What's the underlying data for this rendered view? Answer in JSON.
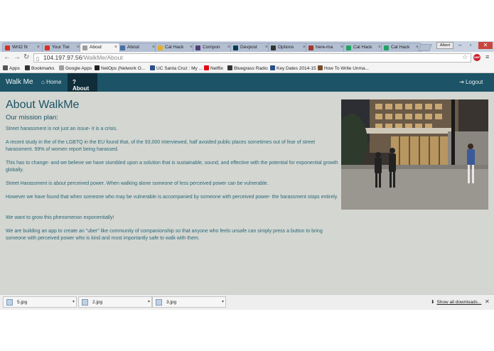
{
  "browser": {
    "tabs": [
      {
        "label": "Writ2 fir",
        "icon": "gmail-icon",
        "color": "#d93025"
      },
      {
        "label": "Your Twi",
        "icon": "gmail-icon",
        "color": "#d93025"
      },
      {
        "label": "About",
        "icon": "page-icon",
        "color": "#9e9e9e"
      },
      {
        "label": "About",
        "icon": "person-icon",
        "color": "#4a6fa5"
      },
      {
        "label": "Cal Hack",
        "icon": "bear-icon",
        "color": "#e0b030"
      },
      {
        "label": "Compon",
        "icon": "bootstrap-icon",
        "color": "#563d7c"
      },
      {
        "label": "Devpost",
        "icon": "devpost-icon",
        "color": "#003e54"
      },
      {
        "label": "Options",
        "icon": "github-icon",
        "color": "#333333"
      },
      {
        "label": "here-ma",
        "icon": "image-icon",
        "color": "#a0392e"
      },
      {
        "label": "Cal Hack",
        "icon": "sheets-icon",
        "color": "#21a366"
      },
      {
        "label": "Cal Hack",
        "icon": "sheets-icon",
        "color": "#21a366"
      }
    ],
    "active_tab_index": 2,
    "user_button": "Albert",
    "url_host": "104.197.97.56",
    "url_path": "/WalkMe/About",
    "bookmarks": [
      {
        "label": "Apps",
        "icon": "apps-grid-icon",
        "color": "#555555"
      },
      {
        "label": "Bookmarks",
        "icon": "star-icon",
        "color": "#333333"
      },
      {
        "label": "Google Apps",
        "icon": "page-icon",
        "color": "#9e9e9e"
      },
      {
        "label": "NetOps (Network O...",
        "icon": "netops-icon",
        "color": "#222222"
      },
      {
        "label": "UC Santa Cruz : My ...",
        "icon": "ucsc-icon",
        "color": "#2a4f8a"
      },
      {
        "label": "Netflix",
        "icon": "netflix-icon",
        "color": "#e50914"
      },
      {
        "label": "Bluegrass Radio",
        "icon": "star-icon",
        "color": "#333333"
      },
      {
        "label": "Key Dates 2014-15",
        "icon": "ucsc-icon",
        "color": "#2a4f8a"
      },
      {
        "label": "How To Write Unma...",
        "icon": "page-icon",
        "color": "#7a4b2a"
      }
    ]
  },
  "site": {
    "brand": "Walk Me",
    "nav_home": "Home",
    "nav_about": "About",
    "nav_logout": "Logout",
    "title": "About WalkMe",
    "subtitle": "Our mission plan:",
    "paragraphs": [
      "Street harassment is not just an issue- it is a crisis.",
      "A recent study in the of the LGBTQ in the EU found that, of the 93,000 interviewed, half avoided public places sometimes out of fear of street harassment. 99% of women report being harassed.",
      "This has to change- and we believe we have stumbled upon a solution that is sustainable, sound, and effective with the potential for exponential growth globally.",
      "Street Harassment is about perceived power. When walking alone someone of less perceived power can be vulnerable.",
      "However we have found that when someone who may be vulnerable is accompanied by someone with perceived power- the harassment stops entirely.",
      "We want to grow this phenomenon exponentially!",
      "We are building an app to create an \"uber\" like community of companionship so that anyone who feels unsafe can simply press a button to bring someone with perceived power who is kind and most importantly safe to walk with them."
    ]
  },
  "downloads": {
    "items": [
      "5.jpg",
      "2.jpg",
      "3.jpg"
    ],
    "show_all": "Show all downloads..."
  }
}
